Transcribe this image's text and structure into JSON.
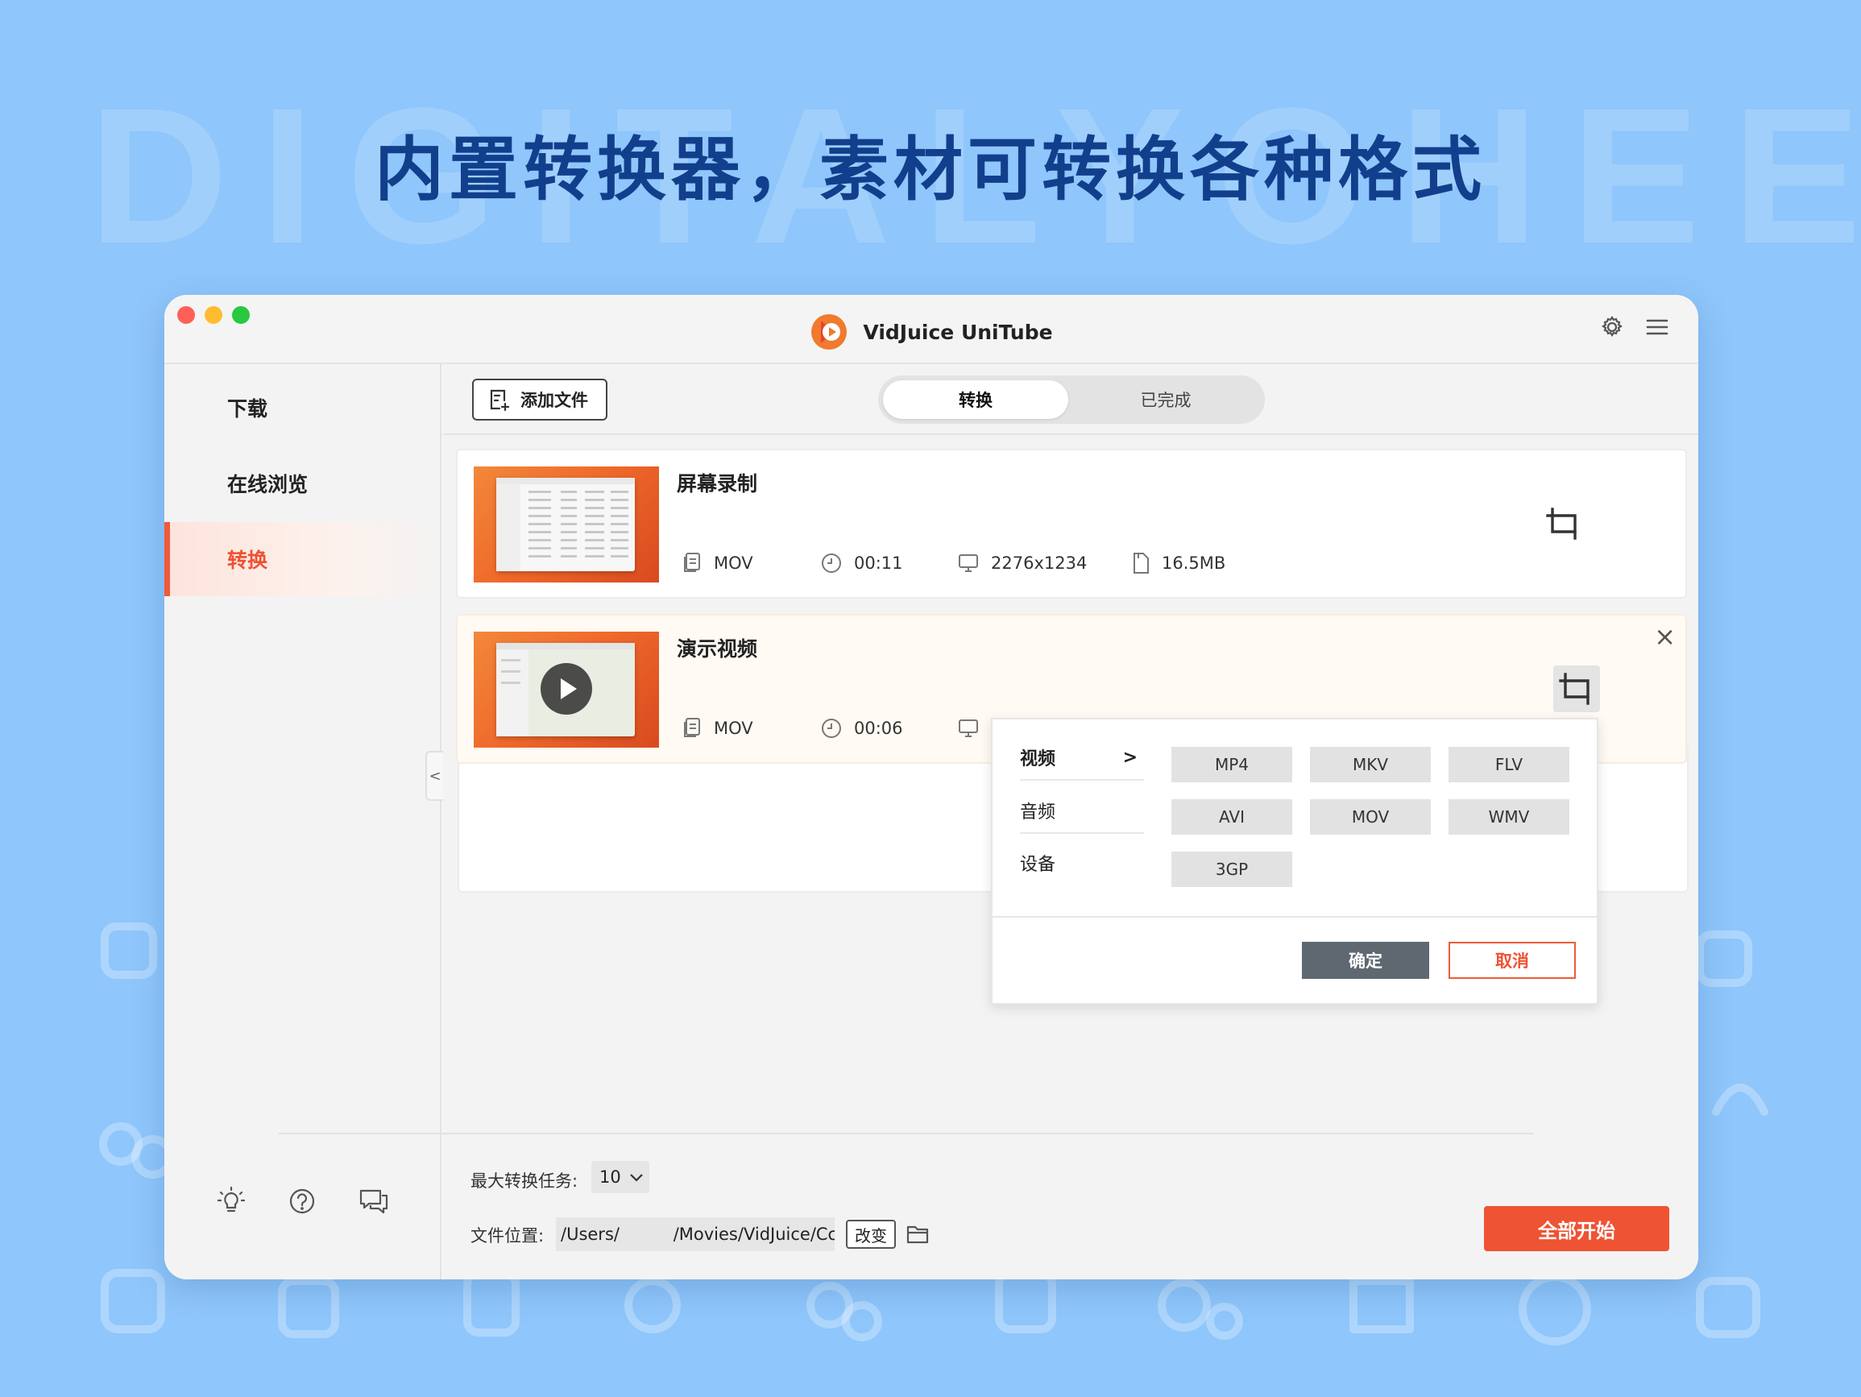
{
  "background": {
    "headline": "内置转换器，素材可转换各种格式",
    "watermark": "DIGITALYOHEE",
    "color": "#8fc6fb",
    "headline_color": "#123f8c"
  },
  "window": {
    "app_title": "VidJuice UniTube",
    "app_icon": "vidjuice-logo-icon",
    "accent_color": "#ee5333"
  },
  "sidebar": {
    "items": [
      {
        "label": "下载",
        "active": false
      },
      {
        "label": "在线浏览",
        "active": false
      },
      {
        "label": "转换",
        "active": true
      }
    ],
    "bottom_icons": [
      "lightbulb-icon",
      "help-icon",
      "feedback-icon"
    ]
  },
  "toolbar": {
    "add_file_label": "添加文件",
    "tabs": [
      {
        "label": "转换",
        "active": true
      },
      {
        "label": "已完成",
        "active": false
      }
    ]
  },
  "files": [
    {
      "title": "屏幕录制",
      "format": "MOV",
      "duration": "00:11",
      "resolution": "2276x1234",
      "size": "16.5MB"
    },
    {
      "title": "演示视频",
      "format": "MOV",
      "duration": "00:06"
    }
  ],
  "format_popup": {
    "categories": [
      {
        "label": "视频",
        "arrow": ">",
        "active": true
      },
      {
        "label": "音频",
        "arrow": "",
        "active": false
      },
      {
        "label": "设备",
        "arrow": "",
        "active": false
      }
    ],
    "formats": [
      "MP4",
      "MKV",
      "FLV",
      "AVI",
      "MOV",
      "WMV",
      "3GP"
    ],
    "ok_label": "确定",
    "cancel_label": "取消"
  },
  "footer": {
    "max_tasks_label": "最大转换任务:",
    "max_tasks_value": "10",
    "location_label": "文件位置:",
    "location_value": "/Users/          /Movies/VidJuice/Cc",
    "change_label": "改变",
    "start_all_label": "全部开始"
  }
}
